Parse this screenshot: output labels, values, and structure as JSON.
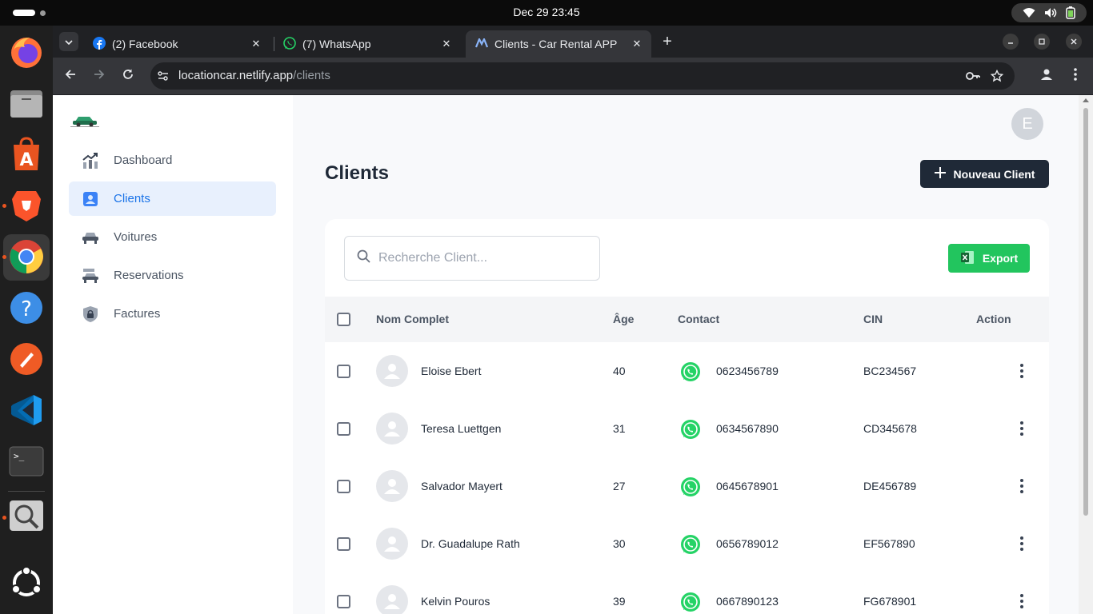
{
  "system": {
    "clock": "Dec 29  23:45"
  },
  "dock": {
    "apps": [
      "firefox-icon",
      "files-icon",
      "app-center-icon",
      "brave-icon",
      "chrome-icon",
      "help-icon",
      "postman-icon",
      "vscode-icon",
      "terminal-icon",
      "image-viewer-icon",
      "ubuntu-show-apps-icon"
    ]
  },
  "browser": {
    "tabs": [
      {
        "title": "(2) Facebook"
      },
      {
        "title": "(7) WhatsApp"
      },
      {
        "title": "Clients - Car Rental APP"
      }
    ],
    "url_host": "locationcar.netlify.app",
    "url_path": "/clients"
  },
  "sidebar": {
    "items": [
      {
        "label": "Dashboard"
      },
      {
        "label": "Clients"
      },
      {
        "label": "Voitures"
      },
      {
        "label": "Reservations"
      },
      {
        "label": "Factures"
      }
    ],
    "active": "Clients"
  },
  "header": {
    "avatar_letter": "E",
    "title": "Clients",
    "new_button": "Nouveau Client"
  },
  "toolbar": {
    "search_placeholder": "Recherche Client...",
    "export_label": "Export"
  },
  "table": {
    "columns": [
      "Nom Complet",
      "Âge",
      "Contact",
      "CIN",
      "Action"
    ],
    "rows": [
      {
        "name": "Eloise Ebert",
        "age": "40",
        "phone": "0623456789",
        "cin": "BC234567"
      },
      {
        "name": "Teresa Luettgen",
        "age": "31",
        "phone": "0634567890",
        "cin": "CD345678"
      },
      {
        "name": "Salvador Mayert",
        "age": "27",
        "phone": "0645678901",
        "cin": "DE456789"
      },
      {
        "name": "Dr. Guadalupe Rath",
        "age": "30",
        "phone": "0656789012",
        "cin": "EF567890"
      },
      {
        "name": "Kelvin Pouros",
        "age": "39",
        "phone": "0667890123",
        "cin": "FG678901"
      }
    ]
  },
  "colors": {
    "accent_blue": "#1a73e8",
    "export_green": "#22c55e",
    "primary_dark": "#1f2937",
    "whatsapp_green": "#25d366"
  }
}
